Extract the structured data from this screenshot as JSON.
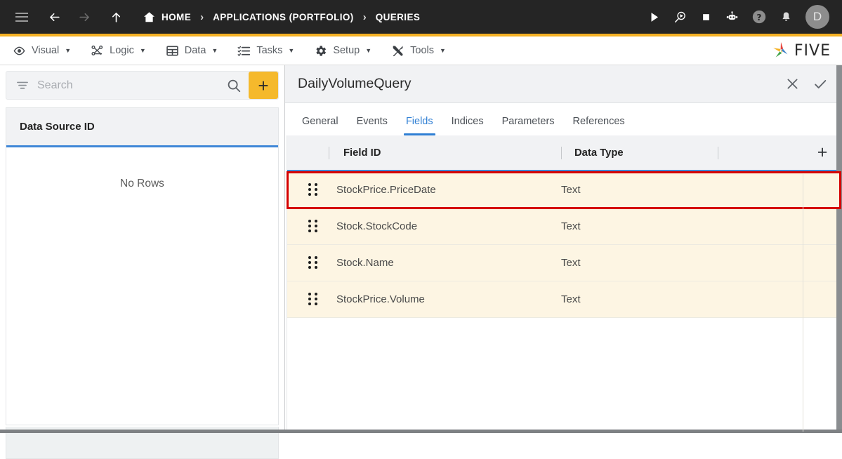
{
  "topbar": {
    "icons": {
      "menu": "hamburger-icon",
      "back": "arrow-back-icon",
      "forward": "arrow-forward-icon",
      "up": "arrow-up-icon",
      "home": "home-icon",
      "run": "play-icon",
      "debug": "debug-magnifier-play-icon",
      "stop": "stop-square-icon",
      "bot": "robot-assistant-icon",
      "help": "help-circle-icon",
      "notifications": "bell-icon"
    },
    "breadcrumbs": [
      {
        "label": "HOME",
        "has_icon": true
      },
      {
        "label": "APPLICATIONS (PORTFOLIO)",
        "has_icon": false
      },
      {
        "label": "QUERIES",
        "has_icon": false
      }
    ],
    "separator": "›",
    "avatar_initial": "D",
    "accent_color": "#f5b124"
  },
  "menubar": {
    "items": [
      {
        "label": "Visual",
        "icon": "eye-icon",
        "caret": "▼"
      },
      {
        "label": "Logic",
        "icon": "logic-nodes-icon",
        "caret": "▼"
      },
      {
        "label": "Data",
        "icon": "table-grid-icon",
        "caret": "▼"
      },
      {
        "label": "Tasks",
        "icon": "checklist-icon",
        "caret": "▼"
      },
      {
        "label": "Setup",
        "icon": "gear-icon",
        "caret": "▼"
      },
      {
        "label": "Tools",
        "icon": "wrench-screwdriver-icon",
        "caret": "▼"
      }
    ],
    "brand": {
      "name": "FIVE",
      "logo_icon": "five-star-logo-icon"
    }
  },
  "sidebar": {
    "search": {
      "placeholder": "Search",
      "value": ""
    },
    "filter_icon": "filter-icon",
    "search_icon": "search-icon",
    "add_button_label": "+",
    "accent_color": "#f5b92c",
    "grid": {
      "column_header": "Data Source ID",
      "empty_message": "No Rows",
      "rows": []
    }
  },
  "main": {
    "title": "DailyVolumeQuery",
    "actions": [
      {
        "label": "",
        "icon": "close-icon",
        "name": "close-button"
      },
      {
        "label": "",
        "icon": "check-icon",
        "name": "confirm-button"
      }
    ],
    "tabs": [
      {
        "label": "General",
        "active": false
      },
      {
        "label": "Events",
        "active": false
      },
      {
        "label": "Fields",
        "active": true
      },
      {
        "label": "Indices",
        "active": false
      },
      {
        "label": "Parameters",
        "active": false
      },
      {
        "label": "References",
        "active": false
      }
    ],
    "fields_table": {
      "columns": [
        "Field ID",
        "Data Type"
      ],
      "add_row_label": "+",
      "rows": [
        {
          "field_id": "StockPrice.PriceDate",
          "data_type": "Text",
          "highlighted": true
        },
        {
          "field_id": "Stock.StockCode",
          "data_type": "Text",
          "highlighted": false
        },
        {
          "field_id": "Stock.Name",
          "data_type": "Text",
          "highlighted": false
        },
        {
          "field_id": "StockPrice.Volume",
          "data_type": "Text",
          "highlighted": false
        }
      ],
      "row_background": "#fdf5e3",
      "highlight_color": "#d50000",
      "header_underline_color": "#3f87d7"
    }
  }
}
